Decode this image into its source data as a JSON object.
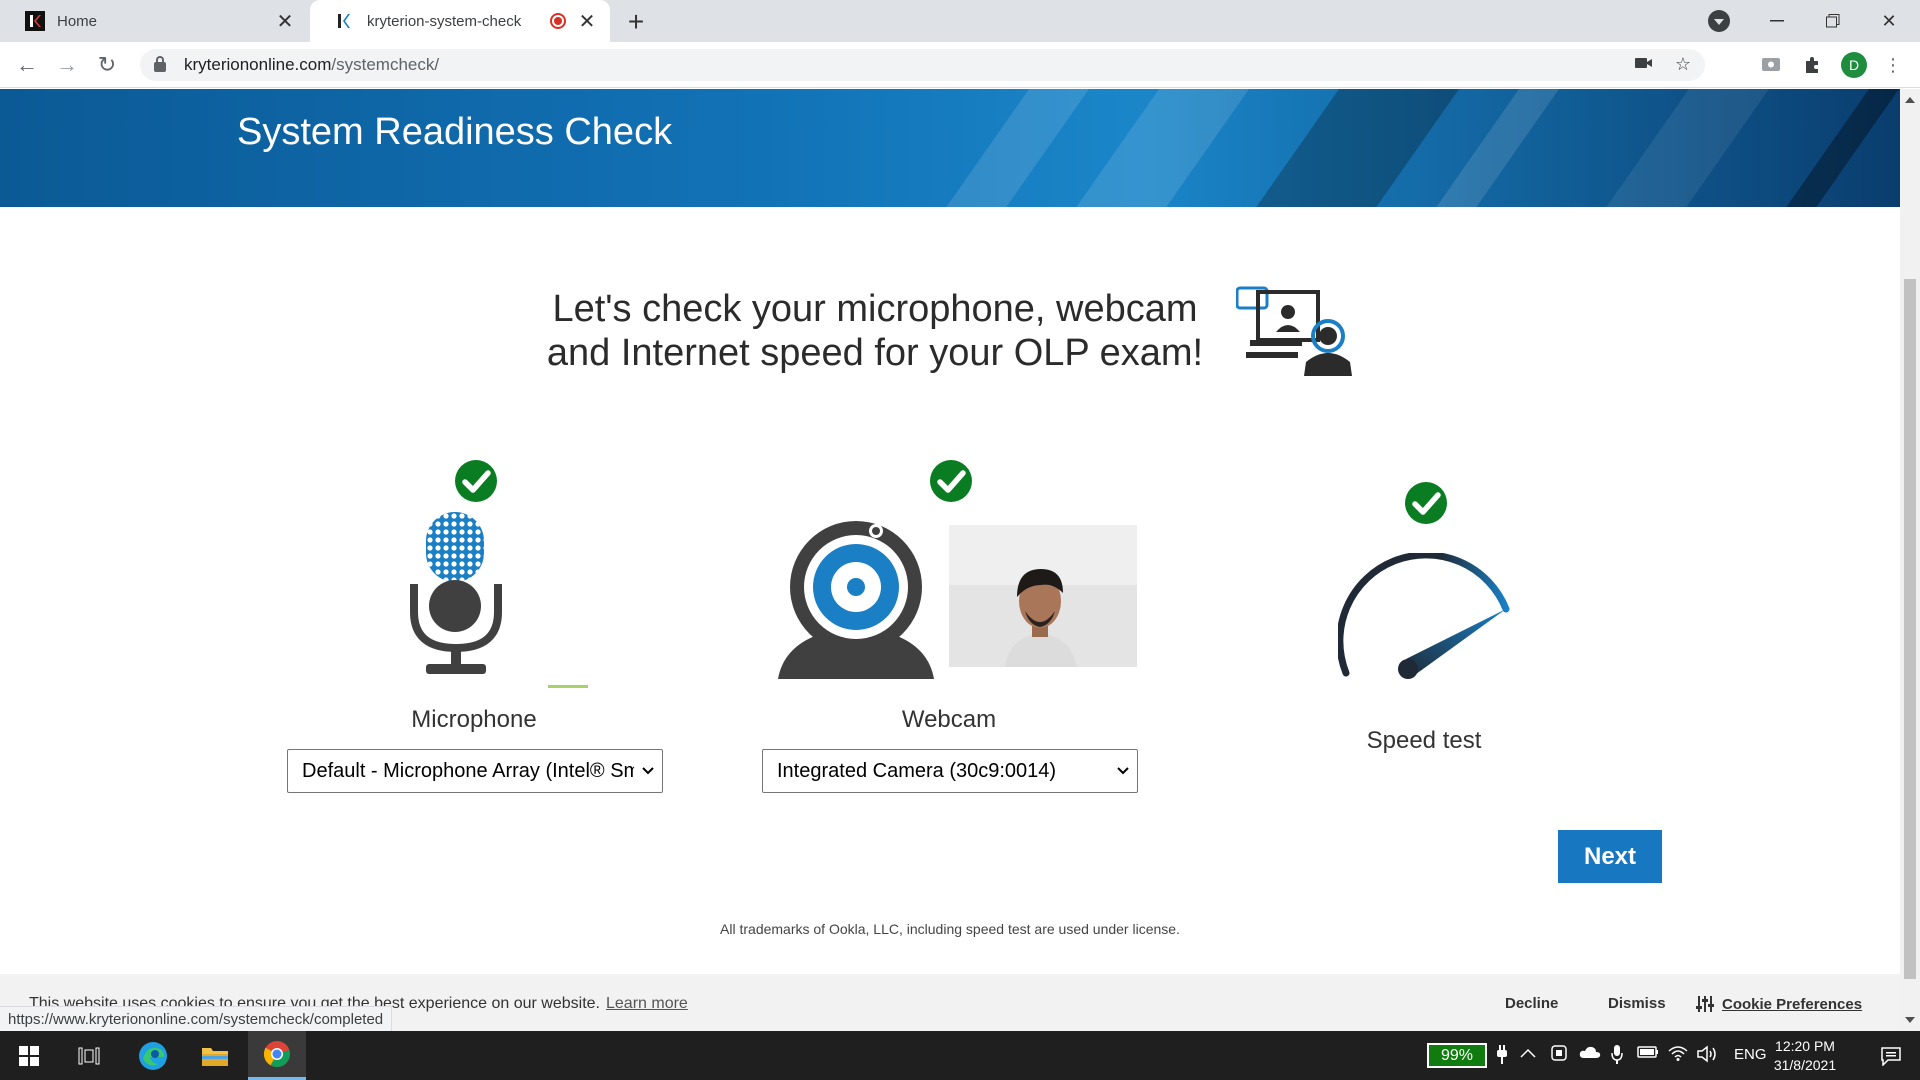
{
  "browser": {
    "tabs": [
      {
        "title": "Home",
        "active": false
      },
      {
        "title": "kryterion-system-check",
        "active": true
      }
    ],
    "url_domain": "kryteriononline.com",
    "url_path": "/systemcheck/",
    "profile_initial": "D"
  },
  "page": {
    "banner_title": "System Readiness Check",
    "headline_line1": "Let's check your microphone, webcam",
    "headline_line2": "and Internet speed for your OLP exam!",
    "microphone": {
      "label": "Microphone",
      "selected_device": "Default - Microphone Array (Intel® Smart Sound Technology)",
      "status": "passed"
    },
    "webcam": {
      "label": "Webcam",
      "selected_device": "Integrated Camera (30c9:0014)",
      "status": "passed"
    },
    "speed_test": {
      "label": "Speed test",
      "status": "passed"
    },
    "next_label": "Next",
    "trademark": "All trademarks of Ookla, LLC, including speed test are used under license."
  },
  "cookie_banner": {
    "message": "This website uses cookies to ensure you get the best experience on our website.",
    "learn_more": "Learn more",
    "decline": "Decline",
    "dismiss": "Dismiss",
    "preferences": "Cookie Preferences"
  },
  "status_url": "https://www.kryteriononline.com/systemcheck/completed",
  "taskbar": {
    "battery": "99%",
    "language": "ENG",
    "time": "12:20 PM",
    "date": "31/8/2021"
  },
  "colors": {
    "banner": "#1272b6",
    "check_green": "#0a7d22",
    "next_button": "#1777c0",
    "accent_blue": "#1a7fc4"
  }
}
